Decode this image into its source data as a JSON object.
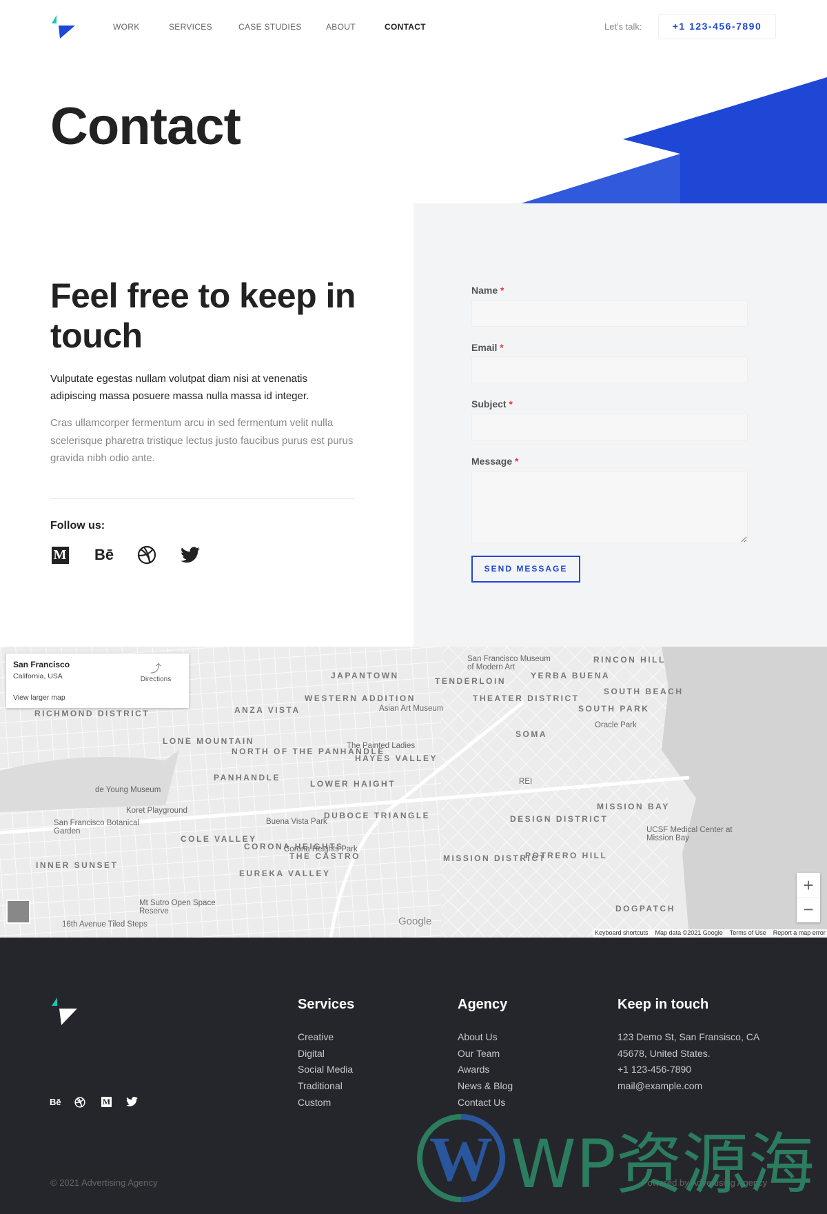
{
  "header": {
    "nav": [
      "WORK",
      "SERVICES",
      "CASE STUDIES",
      "ABOUT",
      "CONTACT"
    ],
    "active": "CONTACT",
    "lets_talk": "Let's talk:",
    "phone": "+1 123-456-7890"
  },
  "hero": {
    "title": "Contact",
    "accent_color": "#1f47d6"
  },
  "intro": {
    "heading": "Feel free to keep in touch",
    "paragraph1": "Vulputate egestas nullam volutpat diam nisi at venenatis adipiscing massa posuere massa nulla massa id integer.",
    "paragraph2": "Cras ullamcorper fermentum arcu in sed fermentum velit nulla scelerisque pharetra tristique lectus justo faucibus purus est purus gravida nibh odio ante.",
    "follow_label": "Follow us:",
    "social": [
      "medium-icon",
      "behance-icon",
      "dribbble-icon",
      "twitter-icon"
    ]
  },
  "form": {
    "fields": [
      {
        "label": "Name",
        "required": "*"
      },
      {
        "label": "Email",
        "required": "*"
      },
      {
        "label": "Subject",
        "required": "*"
      },
      {
        "label": "Message",
        "required": "*"
      }
    ],
    "submit": "SEND MESSAGE"
  },
  "map": {
    "place": "San Francisco",
    "region": "California, USA",
    "directions": "Directions",
    "larger": "View larger map",
    "zoom_in": "+",
    "zoom_out": "−",
    "google": "Google",
    "districts": [
      "JAPANTOWN",
      "RICHMOND DISTRICT",
      "WESTERN ADDITION",
      "ANZA VISTA",
      "LONE MOUNTAIN",
      "NORTH OF THE PANHANDLE",
      "HAYES VALLEY",
      "PANHANDLE",
      "LOWER HAIGHT",
      "DUBOCE TRIANGLE",
      "COLE VALLEY",
      "CORONA HEIGHTS",
      "THE CASTRO",
      "EUREKA VALLEY",
      "INNER SUNSET",
      "TENDERLOIN",
      "YERBA BUENA",
      "RINCON HILL",
      "SOUTH BEACH",
      "THEATER DISTRICT",
      "SOUTH PARK",
      "SOMA",
      "MISSION BAY",
      "DESIGN DISTRICT",
      "MISSION DISTRICT",
      "POTRERO HILL",
      "DOGPATCH"
    ],
    "places": [
      "de Young Museum",
      "San Francisco Botanical Garden",
      "Koret Playground",
      "Buena Vista Park",
      "Corona Heights Park",
      "The Painted Ladies",
      "Asian Art Museum",
      "San Francisco Museum of Modern Art",
      "Oracle Park",
      "REI",
      "UCSF Medical Center at Mission Bay",
      "Mt Sutro Open Space Reserve",
      "16th Avenue Tiled Steps"
    ],
    "attribution": [
      "Keyboard shortcuts",
      "Map data ©2021 Google",
      "Terms of Use",
      "Report a map error"
    ]
  },
  "footer": {
    "columns": [
      {
        "title": "Services",
        "links": [
          "Creative",
          "Digital",
          "Social Media",
          "Traditional",
          "Custom"
        ]
      },
      {
        "title": "Agency",
        "links": [
          "About Us",
          "Our Team",
          "Awards",
          "News & Blog",
          "Contact Us"
        ]
      },
      {
        "title": "Keep in touch",
        "links": [
          "123 Demo St, San Fransisco, CA",
          "45678, United States.",
          "+1 123-456-7890",
          "mail@example.com"
        ]
      }
    ],
    "social": [
      "behance-icon",
      "dribbble-icon",
      "medium-icon",
      "twitter-icon"
    ],
    "copyright": "© 2021 Advertising Agency",
    "powered": "Powered by Advertising Agency"
  },
  "watermark": {
    "text": "WP资源海"
  }
}
